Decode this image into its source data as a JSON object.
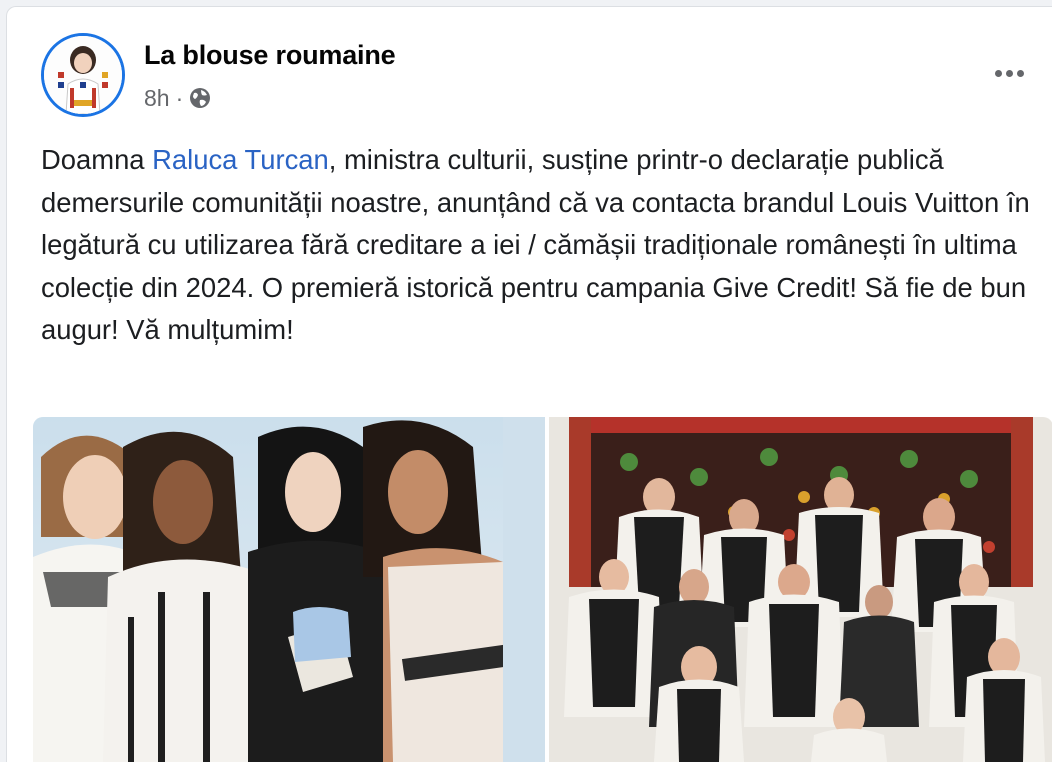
{
  "post": {
    "page_name": "La blouse roumaine",
    "time": "8h",
    "separator": "·",
    "privacy_icon": "globe-icon",
    "more_icon": "more-options-icon",
    "text_before_mention": "Doamna ",
    "mention": "Raluca Turcan",
    "text_after_mention": ", ministra culturii, susține printr-o declarație publică demersurile comunității noastre, anunțând că va contacta brandul Louis Vuitton în legătură cu utilizarea fără creditare a iei / cămășii tradiționale  românești în ultima colecție din 2024. O premieră istorică pentru campania Give Credit! Să fie de bun augur! Vă mulțumim!"
  },
  "colors": {
    "page_bg": "#f0f2f5",
    "card_bg": "#ffffff",
    "mention": "#2a63c4",
    "secondary_text": "#65676b",
    "avatar_ring": "#1b74e4"
  }
}
